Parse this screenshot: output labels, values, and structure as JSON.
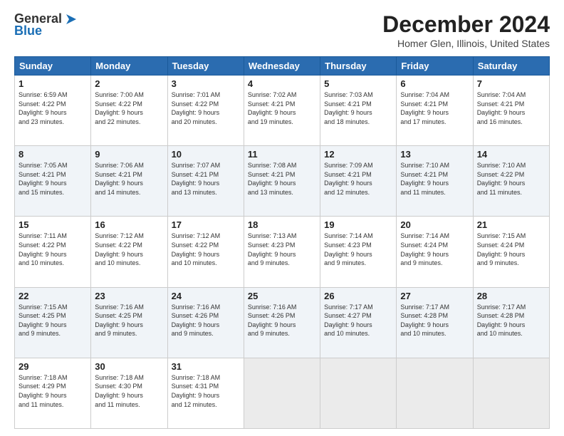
{
  "header": {
    "logo_line1": "General",
    "logo_line2": "Blue",
    "month": "December 2024",
    "location": "Homer Glen, Illinois, United States"
  },
  "days_of_week": [
    "Sunday",
    "Monday",
    "Tuesday",
    "Wednesday",
    "Thursday",
    "Friday",
    "Saturday"
  ],
  "weeks": [
    [
      {
        "day": "1",
        "info": "Sunrise: 6:59 AM\nSunset: 4:22 PM\nDaylight: 9 hours\nand 23 minutes."
      },
      {
        "day": "2",
        "info": "Sunrise: 7:00 AM\nSunset: 4:22 PM\nDaylight: 9 hours\nand 22 minutes."
      },
      {
        "day": "3",
        "info": "Sunrise: 7:01 AM\nSunset: 4:22 PM\nDaylight: 9 hours\nand 20 minutes."
      },
      {
        "day": "4",
        "info": "Sunrise: 7:02 AM\nSunset: 4:21 PM\nDaylight: 9 hours\nand 19 minutes."
      },
      {
        "day": "5",
        "info": "Sunrise: 7:03 AM\nSunset: 4:21 PM\nDaylight: 9 hours\nand 18 minutes."
      },
      {
        "day": "6",
        "info": "Sunrise: 7:04 AM\nSunset: 4:21 PM\nDaylight: 9 hours\nand 17 minutes."
      },
      {
        "day": "7",
        "info": "Sunrise: 7:04 AM\nSunset: 4:21 PM\nDaylight: 9 hours\nand 16 minutes."
      }
    ],
    [
      {
        "day": "8",
        "info": "Sunrise: 7:05 AM\nSunset: 4:21 PM\nDaylight: 9 hours\nand 15 minutes."
      },
      {
        "day": "9",
        "info": "Sunrise: 7:06 AM\nSunset: 4:21 PM\nDaylight: 9 hours\nand 14 minutes."
      },
      {
        "day": "10",
        "info": "Sunrise: 7:07 AM\nSunset: 4:21 PM\nDaylight: 9 hours\nand 13 minutes."
      },
      {
        "day": "11",
        "info": "Sunrise: 7:08 AM\nSunset: 4:21 PM\nDaylight: 9 hours\nand 13 minutes."
      },
      {
        "day": "12",
        "info": "Sunrise: 7:09 AM\nSunset: 4:21 PM\nDaylight: 9 hours\nand 12 minutes."
      },
      {
        "day": "13",
        "info": "Sunrise: 7:10 AM\nSunset: 4:21 PM\nDaylight: 9 hours\nand 11 minutes."
      },
      {
        "day": "14",
        "info": "Sunrise: 7:10 AM\nSunset: 4:22 PM\nDaylight: 9 hours\nand 11 minutes."
      }
    ],
    [
      {
        "day": "15",
        "info": "Sunrise: 7:11 AM\nSunset: 4:22 PM\nDaylight: 9 hours\nand 10 minutes."
      },
      {
        "day": "16",
        "info": "Sunrise: 7:12 AM\nSunset: 4:22 PM\nDaylight: 9 hours\nand 10 minutes."
      },
      {
        "day": "17",
        "info": "Sunrise: 7:12 AM\nSunset: 4:22 PM\nDaylight: 9 hours\nand 10 minutes."
      },
      {
        "day": "18",
        "info": "Sunrise: 7:13 AM\nSunset: 4:23 PM\nDaylight: 9 hours\nand 9 minutes."
      },
      {
        "day": "19",
        "info": "Sunrise: 7:14 AM\nSunset: 4:23 PM\nDaylight: 9 hours\nand 9 minutes."
      },
      {
        "day": "20",
        "info": "Sunrise: 7:14 AM\nSunset: 4:24 PM\nDaylight: 9 hours\nand 9 minutes."
      },
      {
        "day": "21",
        "info": "Sunrise: 7:15 AM\nSunset: 4:24 PM\nDaylight: 9 hours\nand 9 minutes."
      }
    ],
    [
      {
        "day": "22",
        "info": "Sunrise: 7:15 AM\nSunset: 4:25 PM\nDaylight: 9 hours\nand 9 minutes."
      },
      {
        "day": "23",
        "info": "Sunrise: 7:16 AM\nSunset: 4:25 PM\nDaylight: 9 hours\nand 9 minutes."
      },
      {
        "day": "24",
        "info": "Sunrise: 7:16 AM\nSunset: 4:26 PM\nDaylight: 9 hours\nand 9 minutes."
      },
      {
        "day": "25",
        "info": "Sunrise: 7:16 AM\nSunset: 4:26 PM\nDaylight: 9 hours\nand 9 minutes."
      },
      {
        "day": "26",
        "info": "Sunrise: 7:17 AM\nSunset: 4:27 PM\nDaylight: 9 hours\nand 10 minutes."
      },
      {
        "day": "27",
        "info": "Sunrise: 7:17 AM\nSunset: 4:28 PM\nDaylight: 9 hours\nand 10 minutes."
      },
      {
        "day": "28",
        "info": "Sunrise: 7:17 AM\nSunset: 4:28 PM\nDaylight: 9 hours\nand 10 minutes."
      }
    ],
    [
      {
        "day": "29",
        "info": "Sunrise: 7:18 AM\nSunset: 4:29 PM\nDaylight: 9 hours\nand 11 minutes."
      },
      {
        "day": "30",
        "info": "Sunrise: 7:18 AM\nSunset: 4:30 PM\nDaylight: 9 hours\nand 11 minutes."
      },
      {
        "day": "31",
        "info": "Sunrise: 7:18 AM\nSunset: 4:31 PM\nDaylight: 9 hours\nand 12 minutes."
      },
      null,
      null,
      null,
      null
    ]
  ]
}
